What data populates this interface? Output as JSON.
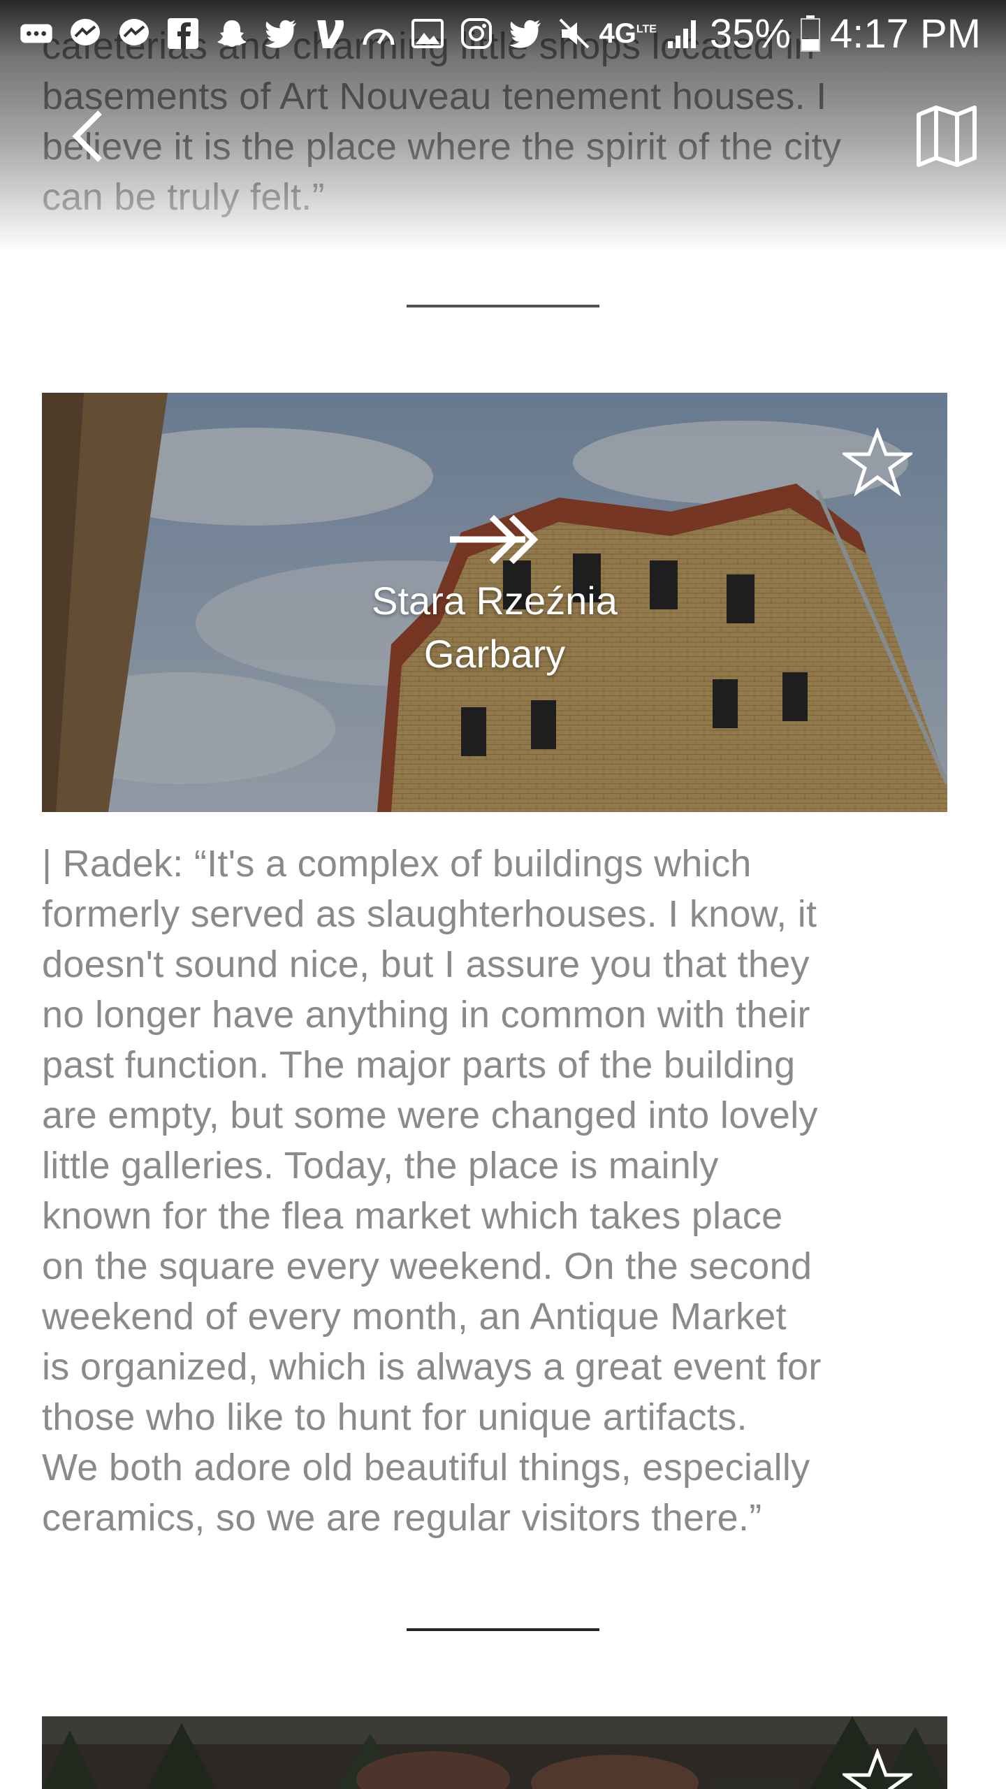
{
  "status_bar": {
    "network": "4G",
    "network_sub": "LTE",
    "battery": "35%",
    "time": "4:17 PM",
    "icons": [
      "more-icon",
      "messenger-icon",
      "messenger-icon",
      "facebook-icon",
      "snapchat-icon",
      "twitter-icon",
      "venmo-icon",
      "speedometer-icon",
      "gallery-icon",
      "instagram-icon",
      "twitter-icon",
      "mute-icon"
    ]
  },
  "toolbar": {
    "back_icon": "chevron-left-icon",
    "map_icon": "map-icon"
  },
  "previous_entry": {
    "text": "cafeterias and charming little shops located in\nbasements of Art Nouveau tenement houses. I\nbelieve it is the place where the spirit of the city\ncan be truly felt.”"
  },
  "place": {
    "name_line1": "Stara Rzeźnia",
    "name_line2": "Garbary",
    "arrow_icon": "double-arrow-right-icon",
    "favorite_icon": "star-outline-icon",
    "description": " | Radek: “It's a complex of buildings which\nformerly served as slaughterhouses. I know, it\ndoesn't sound nice, but I assure you that they\nno longer have anything in common with their\npast function. The major parts of the building\nare empty, but some were changed into lovely\nlittle galleries. Today, the place is mainly\nknown for the flea market which takes place\non the square every weekend. On the second\nweekend of every month, an Antique Market\nis organized, which is always a great event for\nthose who like to hunt for unique artifacts.\nWe both adore old beautiful things, especially\nceramics, so we are regular visitors there.”"
  },
  "next_place": {
    "favorite_icon": "star-outline-icon"
  },
  "colors": {
    "body_text": "#8a8a8a",
    "divider": "#222222",
    "brick": "#c9a868",
    "brick_red": "#9c3d2a"
  }
}
